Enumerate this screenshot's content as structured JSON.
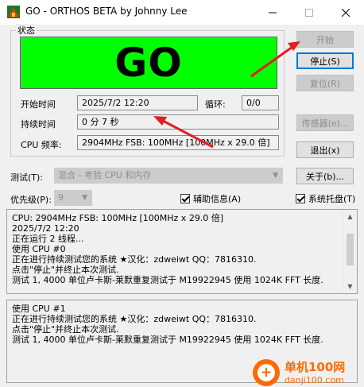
{
  "window": {
    "title": "GO - ORTHOS BETA by Johnny Lee",
    "controls": {
      "minimize": "minimize",
      "maximize": "maximize",
      "close": "close"
    }
  },
  "status": {
    "group_title": "状态",
    "display": "GO",
    "display_color": "#00ff00",
    "start_time_label": "开始时间",
    "start_time_value": "2025/7/2 12:20",
    "loop_label": "循环:",
    "loop_value": "0/0",
    "duration_label": "持续时间",
    "duration_value": "0 分 7 秒",
    "cpu_freq_label": "CPU 频率:",
    "cpu_freq_value": "2904MHz FSB: 100MHz [100MHz x 29.0 倍]"
  },
  "buttons": {
    "start": "开始",
    "stop": "停止(S)",
    "reset": "复位(R)",
    "sensor": "传感器(e)...",
    "exit": "退出(x)",
    "about": "关于(b)..."
  },
  "options": {
    "test_label": "测试(T):",
    "test_value": "混合 - 考验 CPU 和内存",
    "priority_label": "优先级(P):",
    "priority_value": "9",
    "aux_info_label": "辅助信息(A)",
    "aux_info_checked": true,
    "tray_label": "系统托盘(T)",
    "tray_checked": true
  },
  "log1": {
    "lines": [
      "CPU: 2904MHz FSB: 100MHz [100MHz x 29.0 倍]",
      "2025/7/2 12:20",
      "正在运行 2 线程...",
      "使用 CPU #0",
      "正在进行持续测试您的系统    ★汉化：zdweiwt QQ：7816310.",
      "点击\"停止\"并终止本次测试.",
      "测试 1, 4000 单位卢卡斯-莱默重复测试于 M19922945 使用 1024K FFT 长度."
    ]
  },
  "log2": {
    "lines": [
      "使用 CPU #1",
      "正在进行持续测试您的系统    ★汉化：zdweiwt QQ：7816310.",
      "点击\"停止\"并终止本次测试.",
      "测试 1, 4000 单位卢卡斯-莱默重复测试于 M19922945 使用 1024K FFT 长度."
    ]
  },
  "watermark": {
    "line1": "单机100网",
    "line2": "danji100.com"
  },
  "colors": {
    "annotation_arrow": "#e02020",
    "default_button_border": "#0078d7"
  }
}
